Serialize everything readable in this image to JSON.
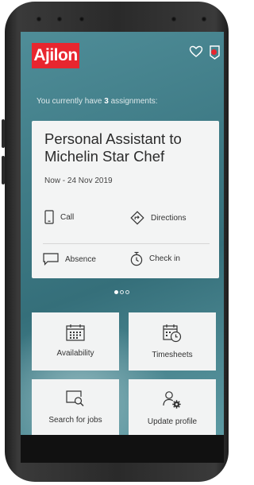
{
  "app": {
    "logo_text": "Ajilon"
  },
  "intro": {
    "prefix": "You currently have ",
    "count": "3",
    "suffix": " assignments:"
  },
  "assignment": {
    "title": "Personal Assistant to Michelin Star Chef",
    "dates": "Now - 24 Nov 2019",
    "actions": {
      "call": "Call",
      "directions": "Directions",
      "absence": "Absence",
      "check_in": "Check in"
    }
  },
  "carousel": {
    "total": 3,
    "active": 1
  },
  "tiles": {
    "availability": "Availability",
    "timesheets": "Timesheets",
    "search_jobs": "Search for jobs",
    "update_profile": "Update profile"
  },
  "colors": {
    "brand_red": "#e8262f",
    "accent_teal": "#3f7b86"
  }
}
